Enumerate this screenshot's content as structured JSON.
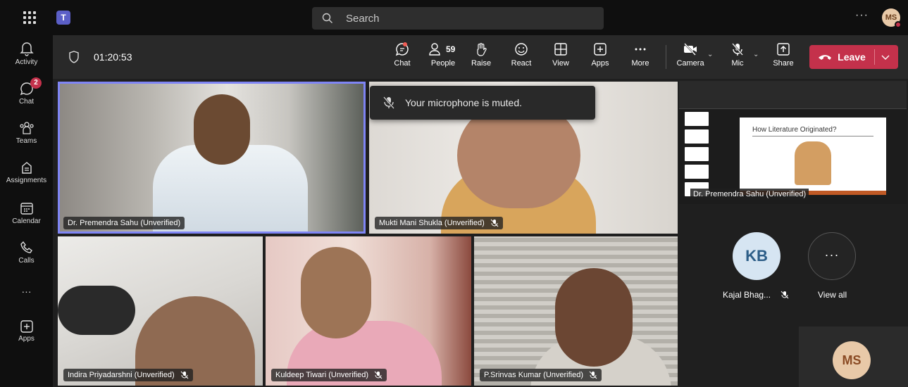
{
  "titlebar": {
    "search_placeholder": "Search",
    "more_label": "···",
    "user_initials": "MS"
  },
  "rail": {
    "items": [
      {
        "label": "Activity",
        "icon": "bell-icon"
      },
      {
        "label": "Chat",
        "icon": "chat-icon",
        "badge": "2"
      },
      {
        "label": "Teams",
        "icon": "teams-icon"
      },
      {
        "label": "Assignments",
        "icon": "assignments-icon"
      },
      {
        "label": "Calendar",
        "icon": "calendar-icon"
      },
      {
        "label": "Calls",
        "icon": "phone-icon"
      },
      {
        "label": "···",
        "icon": "more-icon"
      },
      {
        "label": "Apps",
        "icon": "apps-plus-icon"
      }
    ]
  },
  "meeting": {
    "timer": "01:20:53",
    "controls": {
      "chat": "Chat",
      "people": "People",
      "people_count": "59",
      "raise": "Raise",
      "react": "React",
      "view": "View",
      "apps": "Apps",
      "more": "More",
      "camera": "Camera",
      "mic": "Mic",
      "share": "Share",
      "leave": "Leave"
    },
    "toast": "Your microphone is muted."
  },
  "participants": [
    {
      "name": "Dr. Premendra Sahu (Unverified)",
      "muted": false
    },
    {
      "name": "Mukti Mani Shukla (Unverified)",
      "muted": true
    },
    {
      "name": "Indira Priyadarshni (Unverified)",
      "muted": true
    },
    {
      "name": "Kuldeep Tiwari (Unverified)",
      "muted": true
    },
    {
      "name": "P.Srinvas Kumar (Unverified)",
      "muted": true
    }
  ],
  "sidepanel": {
    "share_name": "Dr. Premendra Sahu (Unverified)",
    "slide_title": "How Literature Originated?",
    "kb_initials": "KB",
    "kb_name": "Kajal Bhag...",
    "view_all": "View all",
    "self_initials": "MS"
  },
  "colors": {
    "accent": "#5b5fc7",
    "active_border": "#7f85f5",
    "leave": "#c4314b",
    "bar": "#292929",
    "rail": "#0f0f0f"
  }
}
